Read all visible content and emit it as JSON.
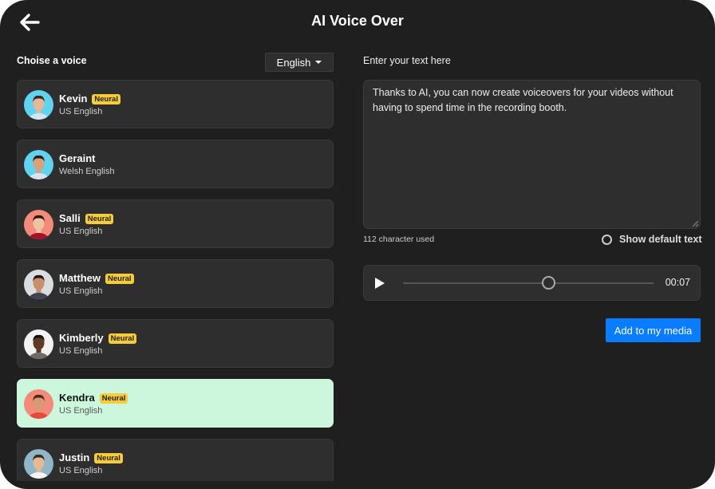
{
  "header": {
    "title": "AI Voice Over",
    "back_icon": "arrow-left-icon"
  },
  "voices_panel": {
    "label": "Choise a voice",
    "language_select": {
      "selected": "English"
    },
    "voices": [
      {
        "name": "Kevin",
        "language": "US English",
        "badge": "Neural",
        "selected": false,
        "avatar_bg": "#5fd3f0",
        "skin": "#e8b796",
        "hair": "#3a2a22",
        "shirt": "#cfe6f5"
      },
      {
        "name": "Geraint",
        "language": "Welsh English",
        "badge": "",
        "selected": false,
        "avatar_bg": "#5fd3f0",
        "skin": "#d9a07a",
        "hair": "#2a1d17",
        "shirt": "#d9e3f0"
      },
      {
        "name": "Salli",
        "language": "US English",
        "badge": "Neural",
        "selected": false,
        "avatar_bg": "#f48a7a",
        "skin": "#f0c2a4",
        "hair": "#2b1810",
        "shirt": "#a3122a"
      },
      {
        "name": "Matthew",
        "language": "US English",
        "badge": "Neural",
        "selected": false,
        "avatar_bg": "#d9dde0",
        "skin": "#c98e6a",
        "hair": "#231813",
        "shirt": "#3d4550"
      },
      {
        "name": "Kimberly",
        "language": "US English",
        "badge": "Neural",
        "selected": false,
        "avatar_bg": "#f2f2f2",
        "skin": "#5e3a25",
        "hair": "#161010",
        "shirt": "#6b6b6b"
      },
      {
        "name": "Kendra",
        "language": "US English",
        "badge": "Neural",
        "selected": true,
        "avatar_bg": "#f48a7a",
        "skin": "#d79a74",
        "hair": "#4a2a18",
        "shirt": "#e8483e"
      },
      {
        "name": "Justin",
        "language": "US English",
        "badge": "Neural",
        "selected": false,
        "avatar_bg": "#8fb6c9",
        "skin": "#e6b994",
        "hair": "#3b2a1e",
        "shirt": "#f5f5f5"
      }
    ]
  },
  "text_panel": {
    "label": "Enter your text here",
    "text": "Thanks to AI, you can now create voiceovers for your videos without having to spend time in the recording booth.",
    "char_count": "112 character used",
    "default_toggle_label": "Show default text",
    "default_toggle_checked": false
  },
  "player": {
    "time": "00:07",
    "progress_percent": 58
  },
  "actions": {
    "add_label": "Add to my media",
    "add_color": "#0a7cff"
  }
}
